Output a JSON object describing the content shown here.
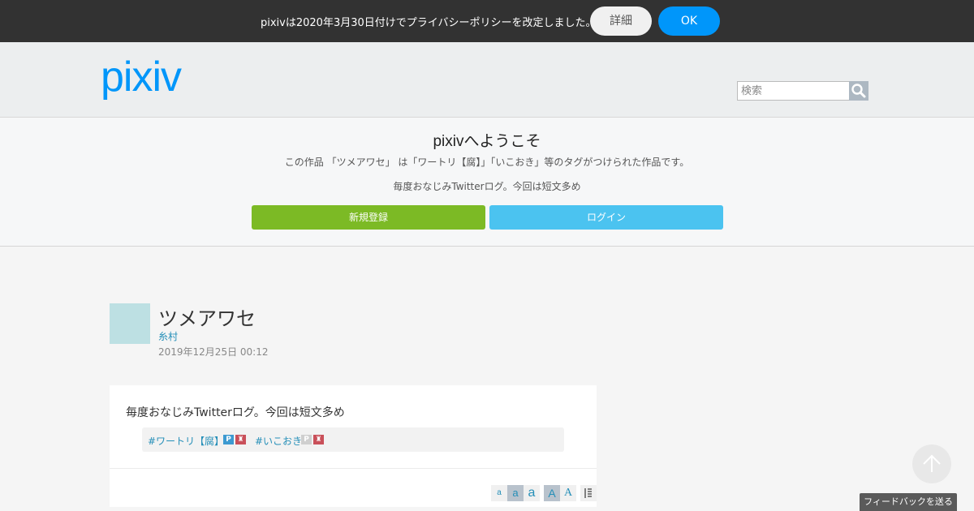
{
  "notice": {
    "text": "pixivは2020年3月30日付けでプライバシーポリシーを改定しました。",
    "detail_label": "詳細",
    "ok_label": "OK"
  },
  "header": {
    "logo_text": "pixiv",
    "search_placeholder": "検索",
    "search_icon": "search-icon"
  },
  "welcome": {
    "title": "pixivへようこそ",
    "description": "この作品 「ツメアワセ」 は「ワートリ【腐】」「いこおき」等のタグがつけられた作品です。",
    "caption": "毎度おなじみTwitterログ。今回は短文多め",
    "signup_label": "新規登録",
    "login_label": "ログイン"
  },
  "work": {
    "title": "ツメアワセ",
    "author": "糸村",
    "date": "2019年12月25日 00:12",
    "caption": "毎度おなじみTwitterログ。今回は短文多め",
    "tags": [
      {
        "label": "#ワートリ【腐】"
      },
      {
        "label": "#いこおき"
      }
    ],
    "font_controls": [
      "a",
      "a",
      "a",
      "A",
      "A"
    ]
  },
  "floating": {
    "scroll_top_icon": "arrow-up-icon",
    "feedback_label": "フィードバックを送る"
  },
  "colors": {
    "notice_bg": "#323232",
    "ok_blue": "#0096fa",
    "signup_green": "#7cba25",
    "login_blue": "#4bc3f0",
    "link": "#258fb8",
    "logo": "#0096fa"
  }
}
